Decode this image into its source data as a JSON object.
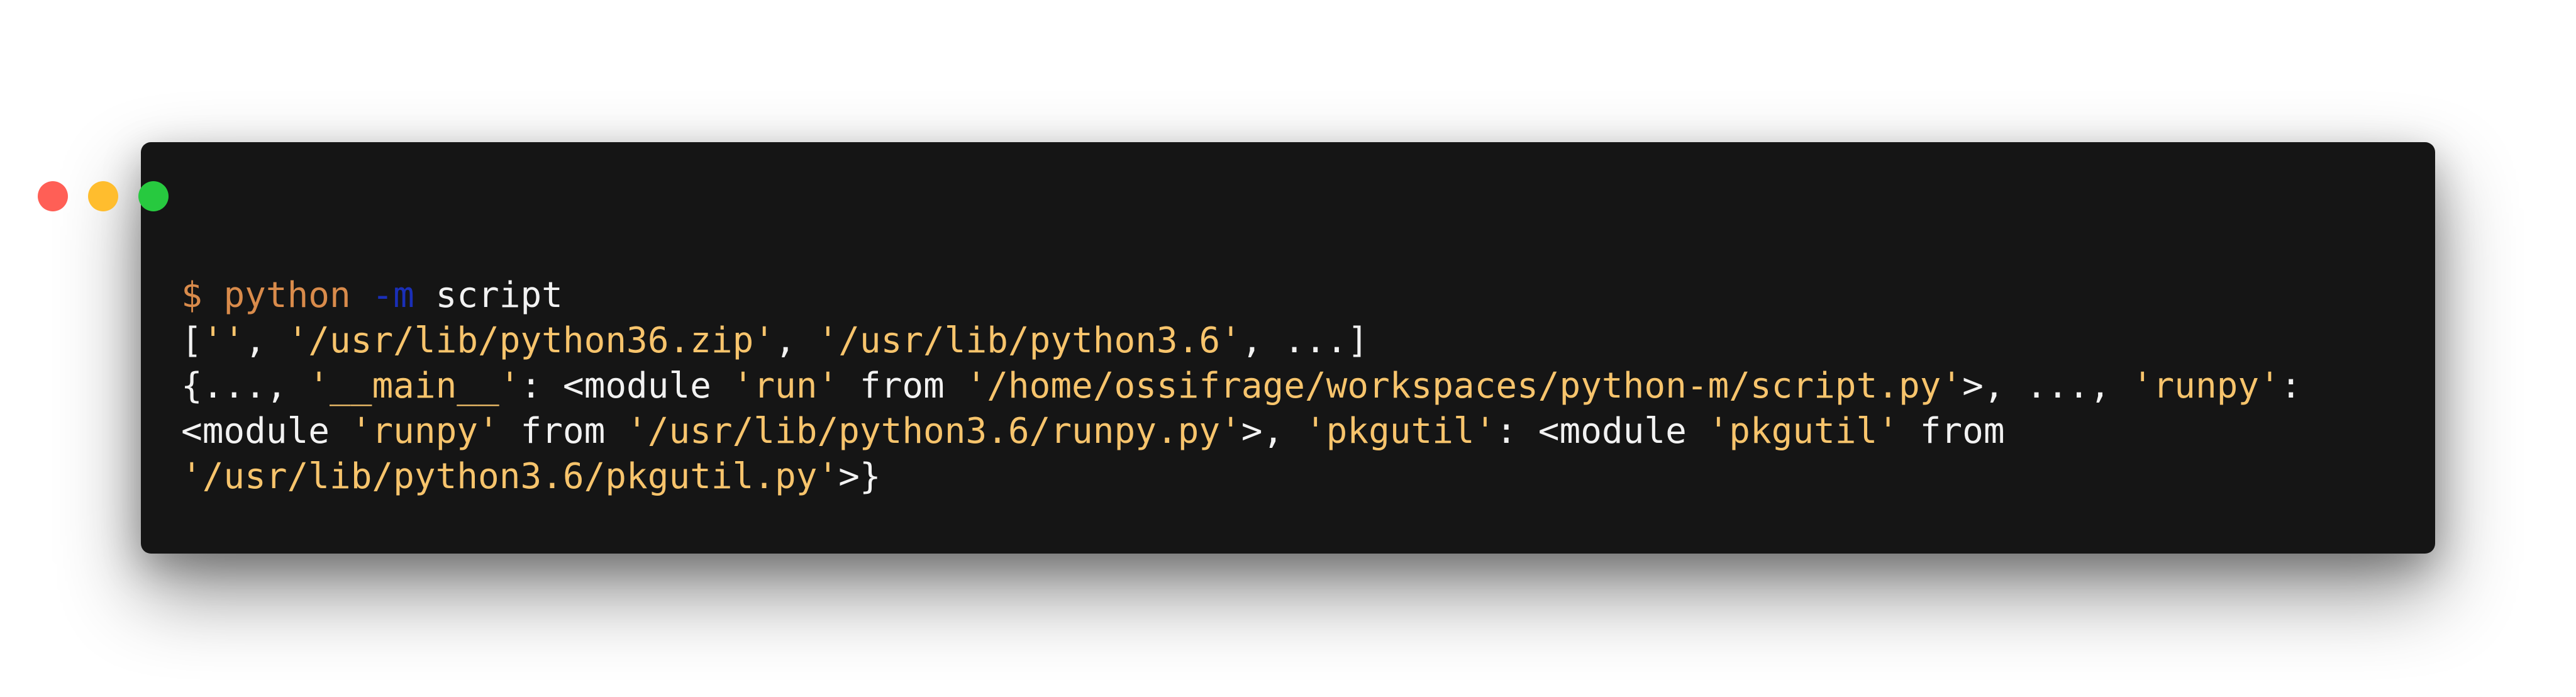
{
  "window": {
    "controls": [
      "close",
      "minimize",
      "zoom"
    ]
  },
  "colors": {
    "prompt": "#d98b4b",
    "command": "#d98b4b",
    "flag": "#1a2fb8",
    "plain": "#f2f2f2",
    "string": "#f7c46c",
    "background": "#151515"
  },
  "lines": [
    [
      {
        "t": "$ ",
        "c": "prompt"
      },
      {
        "t": "python ",
        "c": "command"
      },
      {
        "t": "-m",
        "c": "flag"
      },
      {
        "t": " script",
        "c": "plain"
      }
    ],
    [
      {
        "t": "[",
        "c": "plain"
      },
      {
        "t": "''",
        "c": "string"
      },
      {
        "t": ", ",
        "c": "plain"
      },
      {
        "t": "'/usr/lib/python36.zip'",
        "c": "string"
      },
      {
        "t": ", ",
        "c": "plain"
      },
      {
        "t": "'/usr/lib/python3.6'",
        "c": "string"
      },
      {
        "t": ", ...]",
        "c": "plain"
      }
    ],
    [
      {
        "t": "{..., ",
        "c": "plain"
      },
      {
        "t": "'__main__'",
        "c": "string"
      },
      {
        "t": ": <module ",
        "c": "plain"
      },
      {
        "t": "'run'",
        "c": "string"
      },
      {
        "t": " from ",
        "c": "plain"
      },
      {
        "t": "'/home/ossifrage/workspaces/python-m/script.py'",
        "c": "string"
      },
      {
        "t": ">, ..., ",
        "c": "plain"
      },
      {
        "t": "'runpy'",
        "c": "string"
      },
      {
        "t": ":",
        "c": "plain"
      }
    ],
    [
      {
        "t": "<module ",
        "c": "plain"
      },
      {
        "t": "'runpy'",
        "c": "string"
      },
      {
        "t": " from ",
        "c": "plain"
      },
      {
        "t": "'/usr/lib/python3.6/runpy.py'",
        "c": "string"
      },
      {
        "t": ">, ",
        "c": "plain"
      },
      {
        "t": "'pkgutil'",
        "c": "string"
      },
      {
        "t": ": <module ",
        "c": "plain"
      },
      {
        "t": "'pkgutil'",
        "c": "string"
      },
      {
        "t": " from",
        "c": "plain"
      }
    ],
    [
      {
        "t": "'/usr/lib/python3.6/pkgutil.py'",
        "c": "string"
      },
      {
        "t": ">}",
        "c": "plain"
      }
    ]
  ]
}
